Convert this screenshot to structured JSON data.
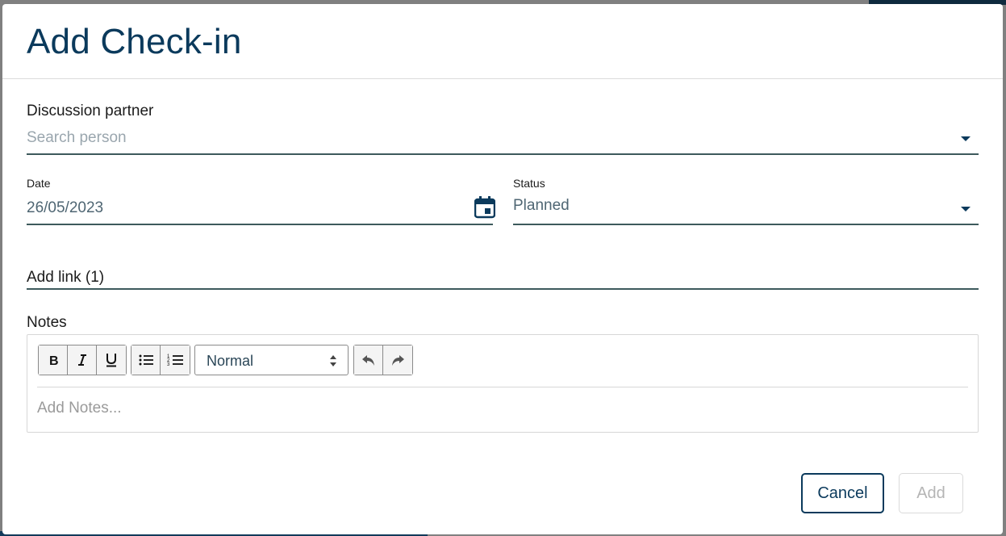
{
  "dialog": {
    "title": "Add Check-in"
  },
  "discussion_partner": {
    "label": "Discussion partner",
    "placeholder": "Search person"
  },
  "date": {
    "label": "Date",
    "value": "26/05/2023"
  },
  "status": {
    "label": "Status",
    "value": "Planned"
  },
  "links": {
    "label": "Add link (1)"
  },
  "notes": {
    "label": "Notes",
    "format_select": "Normal",
    "placeholder": "Add Notes..."
  },
  "footer": {
    "cancel_label": "Cancel",
    "add_label": "Add"
  },
  "colors": {
    "primary": "#0b3a5c",
    "underline": "#3d5a5c",
    "disabled": "#b5b5b5"
  },
  "icons": [
    "chevron-down-icon",
    "calendar-icon",
    "bold-icon",
    "italic-icon",
    "underline-icon",
    "bullet-list-icon",
    "numbered-list-icon",
    "select-arrows-icon",
    "undo-icon",
    "redo-icon"
  ]
}
